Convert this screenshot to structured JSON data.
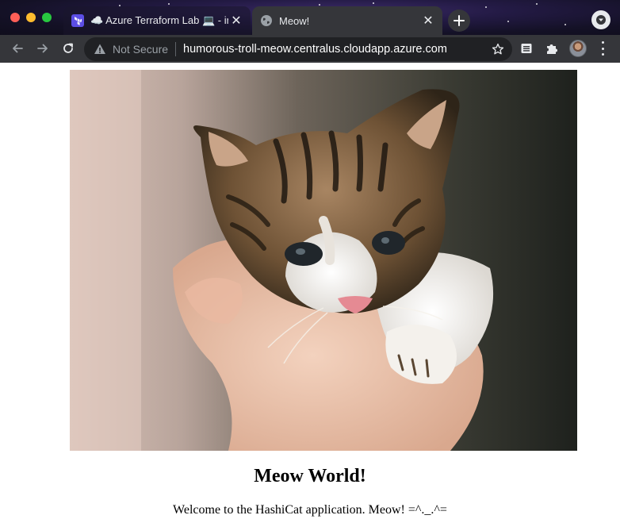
{
  "browser": {
    "tabs": [
      {
        "title": "☁️ Azure Terraform Lab 💻 - in",
        "favicon": "terraform-icon",
        "active": false
      },
      {
        "title": "Meow!",
        "favicon": "globe-icon",
        "active": true
      }
    ],
    "address_bar": {
      "security_label": "Not Secure",
      "url": "humorous-troll-meow.centralus.cloudapp.azure.com"
    },
    "icons": {
      "back": "back-arrow-icon",
      "forward": "forward-arrow-icon",
      "reload": "reload-icon",
      "bookmark": "star-icon",
      "reading_list": "reading-list-icon",
      "extensions": "puzzle-icon",
      "menu": "kebab-menu-icon",
      "new_tab": "plus-icon",
      "tab_search": "chevron-down-icon"
    }
  },
  "page": {
    "image_description": "kitten",
    "title": "Meow World!",
    "welcome_text": "Welcome to the HashiCat application. Meow! =^._.^="
  },
  "colors": {
    "toolbar": "#35363a",
    "omnibox": "#202124",
    "page_background": "#ffffff"
  }
}
